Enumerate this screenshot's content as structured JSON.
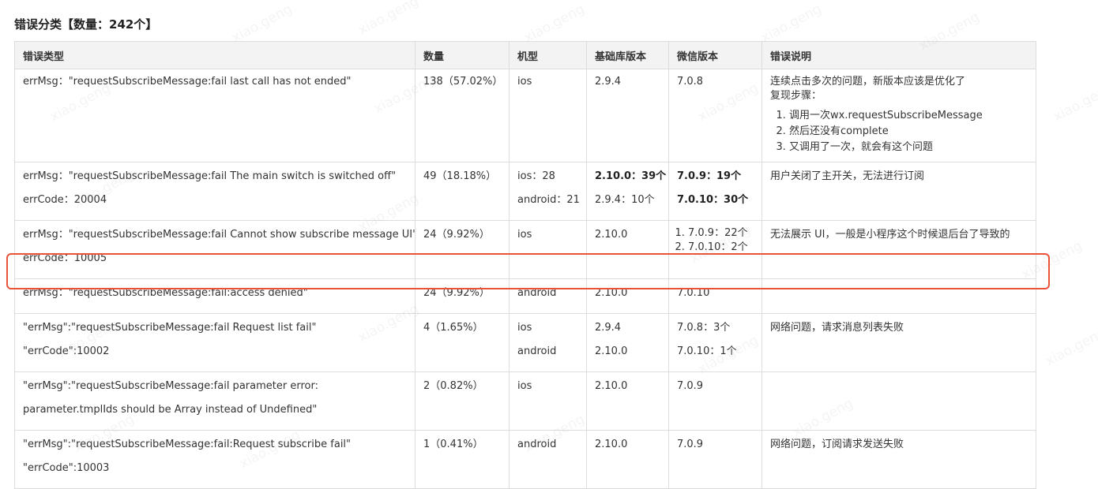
{
  "title": "错误分类【数量：242个】",
  "watermark": "xiao.geng",
  "table": {
    "headers": [
      "错误类型",
      "数量",
      "机型",
      "基础库版本",
      "微信版本",
      "错误说明"
    ],
    "rows": [
      {
        "type_lines": [
          "errMsg：\"requestSubscribeMessage:fail last call has not ended\""
        ],
        "count": "138（57.02%）",
        "device_lines": [
          "ios"
        ],
        "base_lines": [
          "2.9.4"
        ],
        "wechat_lines": [
          "7.0.8"
        ],
        "desc_lines": [
          "连续点击多次的问题，新版本应该是优化了",
          "复现步骤："
        ],
        "desc_steps": [
          "调用一次wx.requestSubscribeMessage",
          "然后还没有complete",
          "又调用了一次，就会有这个问题"
        ]
      },
      {
        "type_lines": [
          "errMsg：\"requestSubscribeMessage:fail The main switch is switched off\"",
          "errCode：20004"
        ],
        "count": "49（18.18%）",
        "device_lines": [
          "ios：28",
          "android：21"
        ],
        "base_lines": [
          "2.10.0：39个",
          "2.9.4：10个"
        ],
        "wechat_lines": [
          "7.0.9：19个",
          "7.0.10：30个"
        ],
        "desc_lines": [
          "用户关闭了主开关，无法进行订阅"
        ]
      },
      {
        "type_lines": [
          "errMsg：\"requestSubscribeMessage:fail Cannot show subscribe message UI\"",
          "errCode：10005"
        ],
        "count": "24（9.92%）",
        "device_lines": [
          "ios"
        ],
        "base_lines": [
          "2.10.0"
        ],
        "wechat_steps": [
          "7.0.9：22个",
          "7.0.10：2个"
        ],
        "desc_lines": [
          "无法展示 UI，一般是小程序这个时候退后台了导致的"
        ]
      },
      {
        "type_lines": [
          "errMsg：\"requestSubscribeMessage:fail:access denied\""
        ],
        "count": "24（9.92%）",
        "device_lines": [
          "android"
        ],
        "base_lines": [
          "2.10.0"
        ],
        "wechat_lines": [
          "7.0.10"
        ],
        "desc_lines": []
      },
      {
        "type_lines": [
          "\"errMsg\":\"requestSubscribeMessage:fail Request list fail\"",
          "\"errCode\":10002"
        ],
        "count": "4（1.65%）",
        "device_lines": [
          "ios",
          "android"
        ],
        "base_lines": [
          "2.9.4",
          "2.10.0"
        ],
        "wechat_lines": [
          "7.0.8：3个",
          "7.0.10：1个"
        ],
        "desc_lines": [
          "网络问题，请求消息列表失败"
        ]
      },
      {
        "type_lines": [
          "\"errMsg\":\"requestSubscribeMessage:fail parameter error:",
          "parameter.tmplIds should be Array instead of Undefined\""
        ],
        "count": "2（0.82%）",
        "device_lines": [
          "ios"
        ],
        "base_lines": [
          "2.10.0"
        ],
        "wechat_lines": [
          "7.0.9"
        ],
        "desc_lines": []
      },
      {
        "type_lines": [
          "\"errMsg\":\"requestSubscribeMessage:fail:Request subscribe fail\"",
          "\"errCode\":10003"
        ],
        "count": "1（0.41%）",
        "device_lines": [
          "android"
        ],
        "base_lines": [
          "2.10.0"
        ],
        "wechat_lines": [
          "7.0.9"
        ],
        "desc_lines": [
          "网络问题，订阅请求发送失败"
        ]
      }
    ]
  }
}
